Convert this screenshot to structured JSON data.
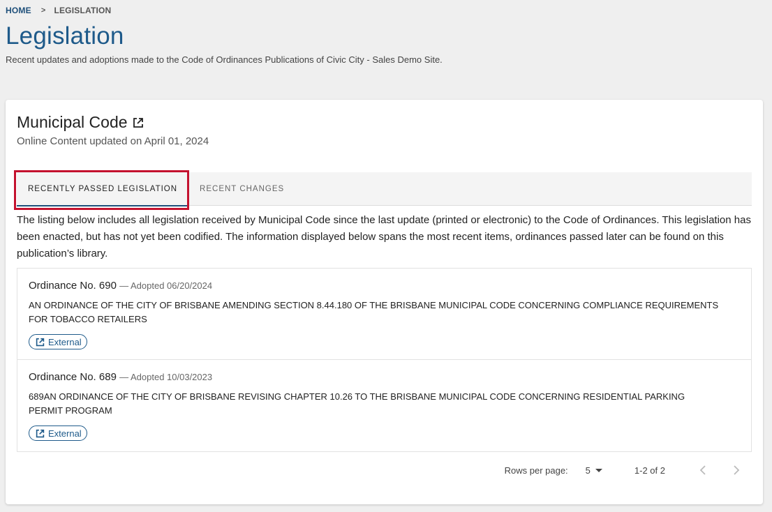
{
  "breadcrumb": {
    "home": "HOME",
    "separator": ">",
    "current": "LEGISLATION"
  },
  "page": {
    "title": "Legislation",
    "subtitle": "Recent updates and adoptions made to the Code of Ordinances Publications of Civic City - Sales Demo Site."
  },
  "card": {
    "title": "Municipal Code",
    "title_icon": "external-link-icon",
    "updated": "Online Content updated on April 01, 2024"
  },
  "tabs": [
    {
      "label": "RECENTLY PASSED LEGISLATION",
      "active": true
    },
    {
      "label": "RECENT CHANGES",
      "active": false
    }
  ],
  "description": "The listing below includes all legislation received by Municipal Code since the last update (printed or electronic) to the Code of Ordinances. This legislation has been enacted, but has not yet been codified. The information displayed below spans the most recent items, ordinances passed later can be found on this publication’s library.",
  "ordinances": [
    {
      "number": "Ordinance No. 690",
      "adopted": "— Adopted 06/20/2024",
      "text": "AN ORDINANCE OF THE CITY OF BRISBANE AMENDING SECTION 8.44.180 OF THE BRISBANE MUNICIPAL CODE CONCERNING COMPLIANCE REQUIREMENTS FOR TOBACCO RETAILERS",
      "button": "External"
    },
    {
      "number": "Ordinance No. 689",
      "adopted": "— Adopted 10/03/2023",
      "text": "689AN ORDINANCE OF THE CITY OF BRISBANE REVISING CHAPTER 10.26 TO THE BRISBANE MUNICIPAL CODE CONCERNING RESIDENTIAL PARKING PERMIT PROGRAM",
      "button": "External"
    }
  ],
  "pagination": {
    "rows_label": "Rows per page:",
    "rows_value": "5",
    "range": "1-2 of 2"
  },
  "colors": {
    "accent": "#1e5a8a",
    "highlight": "#c4122f",
    "background": "#efefef"
  }
}
